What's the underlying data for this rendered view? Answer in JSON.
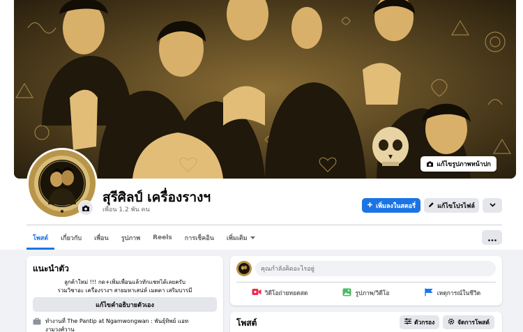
{
  "cover": {
    "edit_button_label": "แก้ไขรูปภาพหน้าปก"
  },
  "profile": {
    "name": "สุรีศิลป์ เครื่องรางฯ",
    "friends_text": "เพื่อน 1.2 พัน คน"
  },
  "actions": {
    "add_story": "เพิ่มลงในสตอรี่",
    "edit_profile": "แก้ไขโปรไฟล์"
  },
  "tabs": [
    {
      "label": "โพสต์"
    },
    {
      "label": "เกี่ยวกับ"
    },
    {
      "label": "เพื่อน"
    },
    {
      "label": "รูปภาพ"
    },
    {
      "label": "Reels"
    },
    {
      "label": "การเช็คอิน"
    },
    {
      "label": "เพิ่มเติม"
    }
  ],
  "intro": {
    "title": "แนะนำตัว",
    "bio_line1": "ลูกค้าใหม่ !!! กด+เพิ่มเพื่อนแล้วทักแชทได้เลยครับ",
    "bio_line2": "รวมวิชาอะ เครื่องรางฯ สายมหาเสน่ห์ เมตตา เสริมบารมี",
    "edit_bio_label": "แก้ไขคำอธิบายตัวเอง",
    "work_line1": "ทำงานที่ The Pantip at Ngamwongwan : พันธุ์ทิพย์ แอท",
    "work_line2": "งามวงศ์วาน"
  },
  "composer": {
    "placeholder": "คุณกำลังคิดอะไรอยู่",
    "live_label": "วิดีโอถ่ายทอดสด",
    "photo_label": "รูปภาพ/วิดีโอ",
    "event_label": "เหตุการณ์ในชีวิต"
  },
  "posts": {
    "title": "โพสต์",
    "filter_label": "ตัวกรอง",
    "manage_label": "จัดการโพสต์"
  },
  "colors": {
    "accent": "#1b74e4",
    "background": "#f0f2f5",
    "live_red": "#f02849",
    "photo_green": "#45bd62",
    "event_blue": "#1877f2"
  }
}
